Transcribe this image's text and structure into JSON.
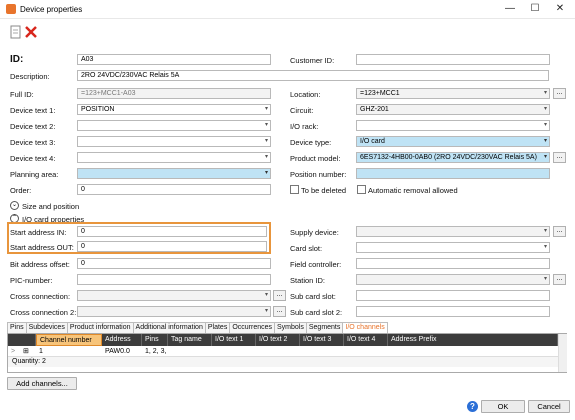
{
  "window": {
    "title": "Device properties"
  },
  "left": {
    "id_label": "ID:",
    "id_value": "A03",
    "description_label": "Description:",
    "description_value": "2RO 24VDC/230VAC Relais 5A",
    "full_id_label": "Full ID:",
    "full_id_value": "=123+MCC1-A03",
    "dt1_label": "Device text 1:",
    "dt1_value": "POSITION",
    "dt2_label": "Device text 2:",
    "dt2_value": "",
    "dt3_label": "Device text 3:",
    "dt3_value": "",
    "dt4_label": "Device text 4:",
    "dt4_value": "",
    "planning_label": "Planning area:",
    "planning_value": "",
    "order_label": "Order:",
    "order_value": "0",
    "size_pos_label": "Size and position",
    "io_props_label": "I/O card properties",
    "start_in_label": "Start address IN:",
    "start_in_value": "0",
    "start_out_label": "Start address OUT:",
    "start_out_value": "0",
    "bit_offset_label": "Bit address offset:",
    "bit_offset_value": "0",
    "pic_label": "PIC-number:",
    "pic_value": "",
    "cross1_label": "Cross connection:",
    "cross1_value": "",
    "cross2_label": "Cross connection 2:",
    "cross2_value": ""
  },
  "right": {
    "customer_id_label": "Customer ID:",
    "customer_id_value": "",
    "location_label": "Location:",
    "location_value": "=123+MCC1",
    "circuit_label": "Circuit:",
    "circuit_value": "GHZ-201",
    "io_rack_label": "I/O rack:",
    "io_rack_value": "",
    "device_type_label": "Device type:",
    "device_type_value": "I/O card",
    "product_model_label": "Product model:",
    "product_model_value": "6ES7132-4HB00-0AB0 (2RO 24VDC/230VAC Relais 5A)",
    "position_number_label": "Position number:",
    "position_number_value": "",
    "to_be_deleted_label": "To be deleted",
    "auto_removal_label": "Automatic removal allowed",
    "supply_label": "Supply device:",
    "supply_value": "",
    "card_slot_label": "Card slot:",
    "card_slot_value": "",
    "field_ctrl_label": "Field controller:",
    "field_ctrl_value": "",
    "station_label": "Station ID:",
    "station_value": "",
    "sub_card_label": "Sub card slot:",
    "sub_card_value": "",
    "sub_card2_label": "Sub card slot 2:",
    "sub_card2_value": ""
  },
  "tabs": [
    "Pins",
    "Subdevices",
    "Product information",
    "Additional information",
    "Plates",
    "Occurrences",
    "Symbols",
    "Segments",
    "I/O channels"
  ],
  "grid": {
    "columns": [
      "Channel number",
      "Address",
      "Pins",
      "Tag name",
      "I/O text 1",
      "I/O text 2",
      "I/O text 3",
      "I/O text 4",
      "Address Prefix"
    ],
    "row": {
      "expander": ">",
      "plus": "⊞",
      "channel": "1",
      "address": "PAW0.0",
      "pins": "1, 2, 3, ."
    },
    "quantity": "Quantity: 2"
  },
  "buttons": {
    "add_channels": "Add channels...",
    "ok": "OK",
    "cancel": "Cancel"
  },
  "icons": {
    "minimize": "—",
    "maximize": "☐",
    "close": "✕",
    "help": "?"
  }
}
